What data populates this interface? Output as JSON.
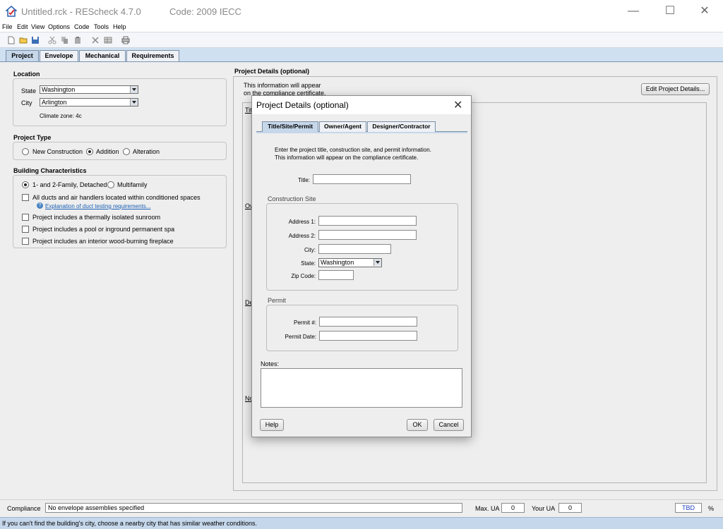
{
  "window": {
    "title": "Untitled.rck - REScheck 4.7.0",
    "code_label": "Code: 2009 IECC",
    "minimize_glyph": "—",
    "maximize_glyph": "☐",
    "close_glyph": "✕"
  },
  "menu": [
    "File",
    "Edit",
    "View",
    "Options",
    "Code",
    "Tools",
    "Help"
  ],
  "toolbar_icons": [
    "new-file-icon",
    "open-folder-icon",
    "save-icon",
    "cut-icon",
    "copy-icon",
    "paste-icon",
    "delete-icon",
    "table-icon",
    "print-icon"
  ],
  "tabs": [
    {
      "label": "Project",
      "active": true
    },
    {
      "label": "Envelope",
      "active": false
    },
    {
      "label": "Mechanical",
      "active": false
    },
    {
      "label": "Requirements",
      "active": false
    }
  ],
  "location": {
    "heading": "Location",
    "state_label": "State",
    "state_value": "Washington",
    "city_label": "City",
    "city_value": "Arlington",
    "climate_zone": "Climate zone: 4c"
  },
  "project_type": {
    "heading": "Project Type",
    "options": [
      {
        "label": "New Construction",
        "selected": false
      },
      {
        "label": "Addition",
        "selected": true
      },
      {
        "label": "Alteration",
        "selected": false
      }
    ]
  },
  "building": {
    "heading": "Building Characteristics",
    "family_options": [
      {
        "label": "1- and 2-Family, Detached",
        "selected": true
      },
      {
        "label": "Multifamily",
        "selected": false
      }
    ],
    "ducts_label": "All ducts and air handlers located within conditioned spaces",
    "duct_link": "Explanation of duct testing requirements...",
    "checks": [
      "Project includes a thermally isolated sunroom",
      "Project includes a pool or inground permanent spa",
      "Project includes an interior wood-burning fireplace"
    ]
  },
  "project_details": {
    "heading": "Project Details (optional)",
    "info_line1": "This information will appear",
    "info_line2": "on the compliance certificate.",
    "edit_button": "Edit Project Details...",
    "clipped_labels": [
      "Tit",
      "Ow",
      "De",
      "No"
    ]
  },
  "dialog": {
    "title": "Project Details (optional)",
    "close_glyph": "✕",
    "tabs": [
      {
        "label": "Title/Site/Permit",
        "active": true
      },
      {
        "label": "Owner/Agent",
        "active": false
      },
      {
        "label": "Designer/Contractor",
        "active": false
      }
    ],
    "intro_line1": "Enter the project title, construction site, and permit information.",
    "intro_line2": "This information will appear on the compliance certificate.",
    "title_label": "Title:",
    "site_heading": "Construction Site",
    "address1_label": "Address 1:",
    "address2_label": "Address 2:",
    "city_label": "City:",
    "state_label": "State:",
    "state_value": "Washington",
    "zip_label": "Zip Code:",
    "permit_heading": "Permit",
    "permit_no_label": "Permit #:",
    "permit_date_label": "Permit Date:",
    "notes_label": "Notes:",
    "help_button": "Help",
    "ok_button": "OK",
    "cancel_button": "Cancel"
  },
  "compliance": {
    "label": "Compliance",
    "message": "No envelope assemblies specified",
    "max_ua_label": "Max. UA",
    "max_ua_value": "0",
    "your_ua_label": "Your UA",
    "your_ua_value": "0",
    "result": "TBD",
    "percent": "%"
  },
  "status_message": "If you can't find the building's city, choose a nearby city that has similar weather conditions."
}
